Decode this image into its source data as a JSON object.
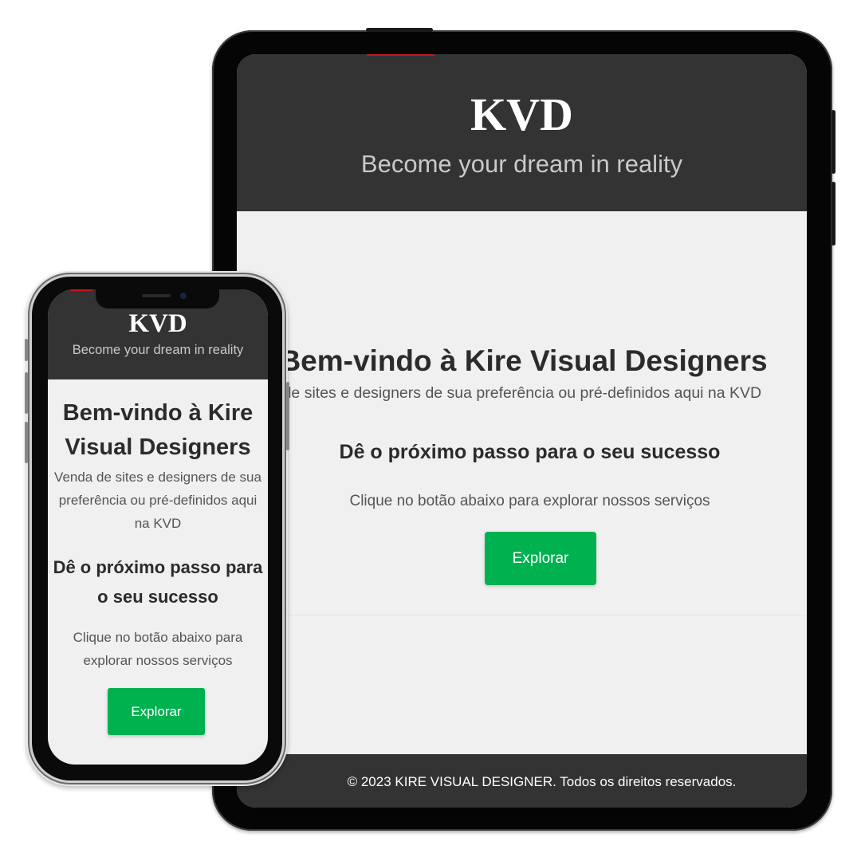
{
  "site": {
    "logo": "KVD",
    "tagline": "Become your dream in reality"
  },
  "hero": {
    "heading": "Bem-vindo à Kire Visual Designers",
    "description": "Venda de sites e designers de sua preferência ou pré-definidos aqui na KVD",
    "subheading": "Dê o próximo passo para o seu sucesso",
    "cta_text": "Clique no botão abaixo para explorar nossos serviços",
    "cta_button": "Explorar"
  },
  "footer": {
    "copyright": "© 2023 KIRE VISUAL DESIGNER. Todos os direitos reservados."
  },
  "colors": {
    "header_bg": "#333333",
    "page_bg": "#f0f0f0",
    "accent_button": "#00b14f",
    "accent_red": "#c6161d"
  }
}
